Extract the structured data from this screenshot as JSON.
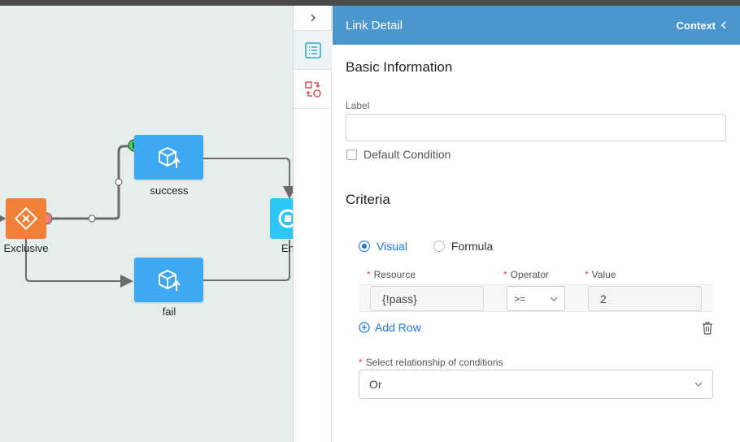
{
  "canvas": {
    "nodes": [
      {
        "label": "success",
        "icon": "deploy-icon"
      },
      {
        "label": "fail",
        "icon": "deploy-icon"
      }
    ],
    "gateway": {
      "label": "Exclusive",
      "icon": "gateway-icon"
    },
    "end_node": {
      "label": "End"
    },
    "colors": {
      "task": "#3fa8f2",
      "gateway": "#f07f38",
      "end": "#2ec7f5",
      "link": "#6b6b6b",
      "background": "#e6eeed"
    }
  },
  "toolstrip": {
    "collapse_icon": "chevron-right-icon",
    "items": [
      {
        "icon": "list-icon",
        "active": true
      },
      {
        "icon": "flow-swap-icon",
        "active": false
      }
    ]
  },
  "panel": {
    "title": "Link Detail",
    "context_label": "Context",
    "basic_section": "Basic Information",
    "label_field": {
      "label": "Label",
      "value": ""
    },
    "default_condition": {
      "label": "Default Condition",
      "checked": false
    },
    "criteria_section": "Criteria",
    "mode_options": [
      {
        "label": "Visual",
        "selected": true
      },
      {
        "label": "Formula",
        "selected": false
      }
    ],
    "columns": {
      "resource": "Resource",
      "operator": "Operator",
      "value": "Value",
      "required_mark": "*"
    },
    "rows": [
      {
        "resource": "{!pass}",
        "operator": ">=",
        "value": "2"
      }
    ],
    "add_row_label": "Add Row",
    "relationship": {
      "label": "Select relationship of conditions",
      "value": "Or"
    },
    "accent_color": "#4a97d0"
  }
}
